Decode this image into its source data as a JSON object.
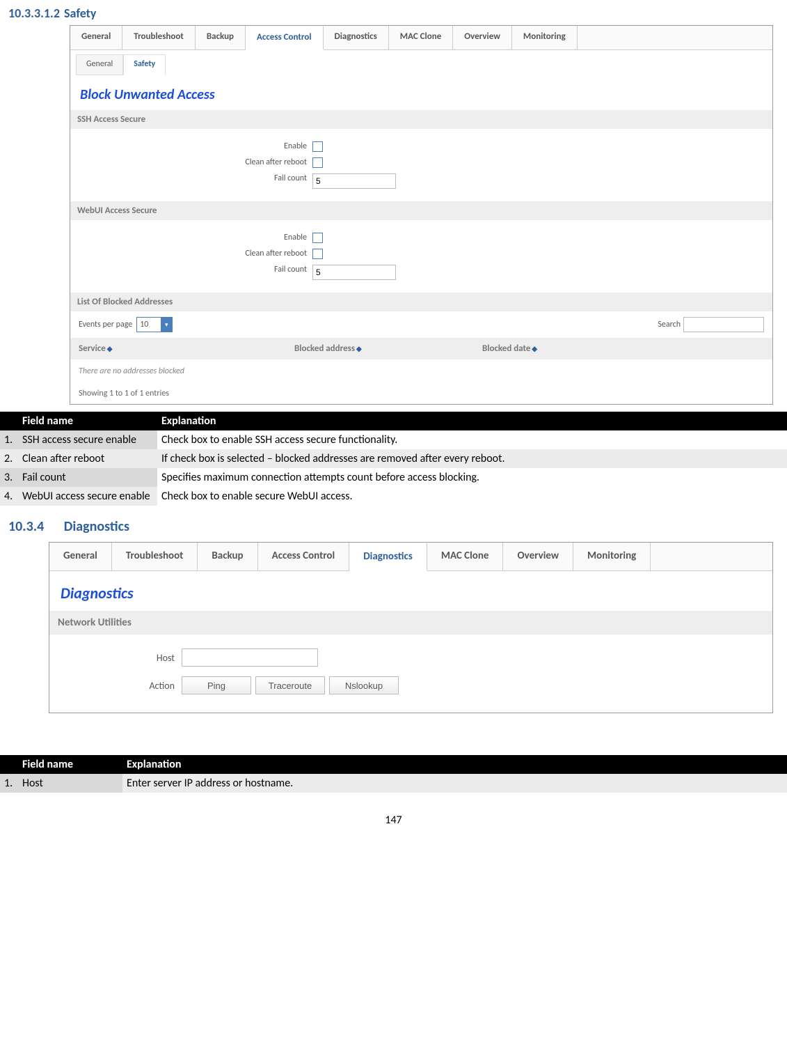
{
  "section1": {
    "heading_num": "10.3.3.1.2",
    "heading_text": "Safety",
    "tabs": [
      "General",
      "Troubleshoot",
      "Backup",
      "Access Control",
      "Diagnostics",
      "MAC Clone",
      "Overview",
      "Monitoring"
    ],
    "active_tab": "Access Control",
    "subtabs": [
      "General",
      "Safety"
    ],
    "active_subtab": "Safety",
    "panel_title": "Block Unwanted Access",
    "ssh_header": "SSH Access Secure",
    "ssh": {
      "enable": "Enable",
      "clean": "Clean after reboot",
      "failcount": "Fail count",
      "failcount_val": "5"
    },
    "web_header": "WebUI Access Secure",
    "web": {
      "enable": "Enable",
      "clean": "Clean after reboot",
      "failcount": "Fail count",
      "failcount_val": "5"
    },
    "list_header": "List Of Blocked Addresses",
    "events_label": "Events per page",
    "events_val": "10",
    "search_label": "Search",
    "cols": {
      "c1": "Service",
      "c2": "Blocked address",
      "c3": "Blocked date"
    },
    "empty": "There are no addresses blocked",
    "showing": "Showing 1 to 1 of 1 entries"
  },
  "table1": {
    "hd_field": "Field name",
    "hd_expl": "Explanation",
    "rows": [
      {
        "n": "1.",
        "f": "SSH access  secure enable",
        "e": "Check box to enable SSH access secure functionality."
      },
      {
        "n": "2.",
        "f": "Clean after reboot",
        "e": "If check box is selected – blocked addresses are removed after every reboot."
      },
      {
        "n": "3.",
        "f": "Fail count",
        "e": "Specifies maximum connection attempts count before access blocking."
      },
      {
        "n": "4.",
        "f": "WebUI access secure enable",
        "e": "Check box to enable secure WebUI access."
      }
    ]
  },
  "section2": {
    "heading_num": "10.3.4",
    "heading_text": "Diagnostics",
    "tabs": [
      "General",
      "Troubleshoot",
      "Backup",
      "Access Control",
      "Diagnostics",
      "MAC Clone",
      "Overview",
      "Monitoring"
    ],
    "active_tab": "Diagnostics",
    "panel_title": "Diagnostics",
    "sec_header": "Network Utilities",
    "host_label": "Host",
    "action_label": "Action",
    "buttons": [
      "Ping",
      "Traceroute",
      "Nslookup"
    ]
  },
  "table2": {
    "hd_field": "Field name",
    "hd_expl": "Explanation",
    "rows": [
      {
        "n": "1.",
        "f": "Host",
        "e": "Enter server IP address or hostname."
      }
    ]
  },
  "page_number": "147"
}
